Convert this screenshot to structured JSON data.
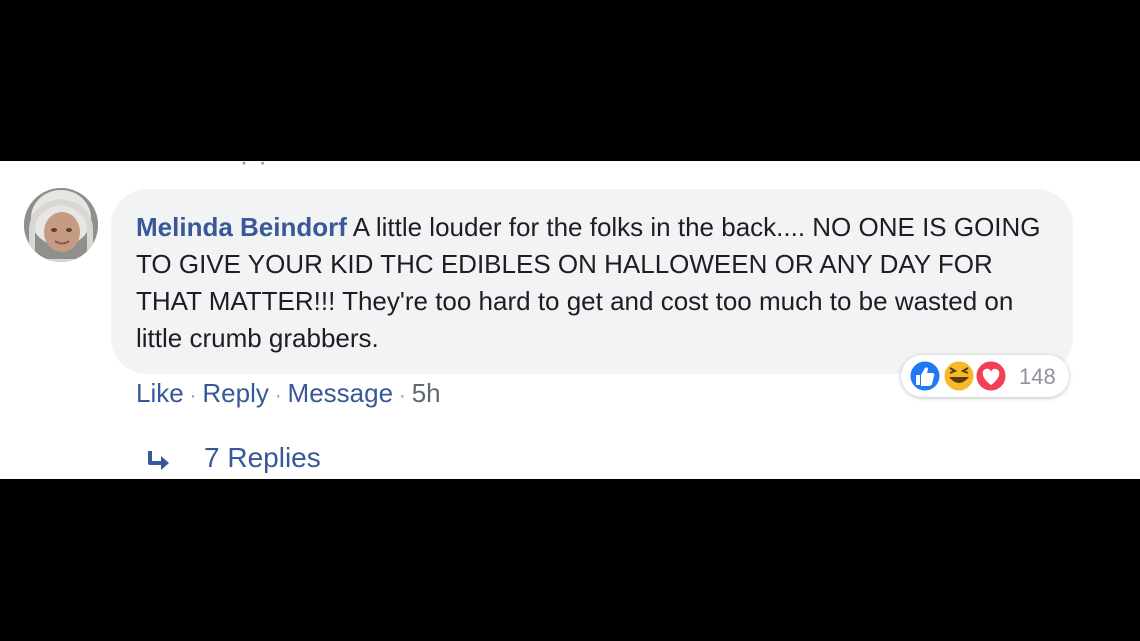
{
  "comment": {
    "author": "Melinda Beindorf",
    "text": "A little louder for the folks in the back.... NO ONE IS GOING TO GIVE YOUR KID THC EDIBLES ON HALLOWEEN OR ANY DAY FOR THAT MATTER!!! They're too hard to get and cost too much to be wasted on little crumb grabbers.",
    "actions": {
      "like": "Like",
      "reply": "Reply",
      "message": "Message",
      "separator": "·",
      "time": "5h"
    },
    "reactions": {
      "icons": [
        "like-icon",
        "haha-icon",
        "love-icon"
      ],
      "count": "148"
    },
    "replies_label": "7 Replies"
  },
  "colors": {
    "author_link": "#385898",
    "bubble_bg": "#f2f3f5",
    "like_blue": "#2078f4",
    "haha_yellow": "#f7b928",
    "love_red": "#f33e58"
  }
}
